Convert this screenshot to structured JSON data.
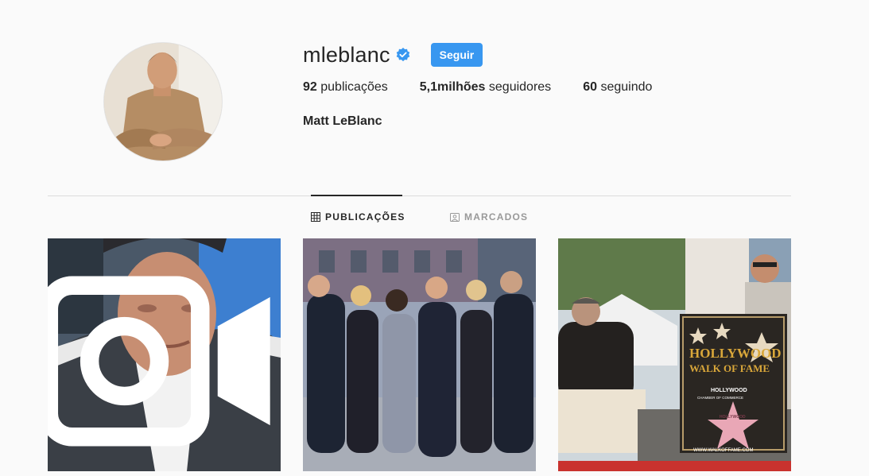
{
  "profile": {
    "username": "mleblanc",
    "verified": true,
    "follow_label": "Seguir",
    "full_name": "Matt LeBlanc",
    "stats": {
      "posts_count": "92",
      "posts_label": "publicações",
      "followers_count": "5,1milhões",
      "followers_label": "seguidores",
      "following_count": "60",
      "following_label": "seguindo"
    }
  },
  "tabs": [
    {
      "label": "PUBLICAÇÕES",
      "icon": "grid-icon",
      "active": true
    },
    {
      "label": "MARCADOS",
      "icon": "tagged-icon",
      "active": false
    }
  ],
  "posts": [
    {
      "type": "video",
      "icon": "video-icon"
    },
    {
      "type": "photo"
    },
    {
      "type": "photo",
      "sign": {
        "line1": "HOLLYWOOD",
        "line2": "WALK OF FAME",
        "line3": "HOLLYWOOD",
        "line4": "CHAMBER OF COMMERCE",
        "star_text": "HOLLYWOOD",
        "url": "WWW.WALKOFFAME.COM"
      }
    }
  ],
  "colors": {
    "accent": "#3897f0",
    "text": "#262626",
    "muted": "#999999",
    "background": "#fafafa",
    "divider": "#dbdbdb"
  }
}
